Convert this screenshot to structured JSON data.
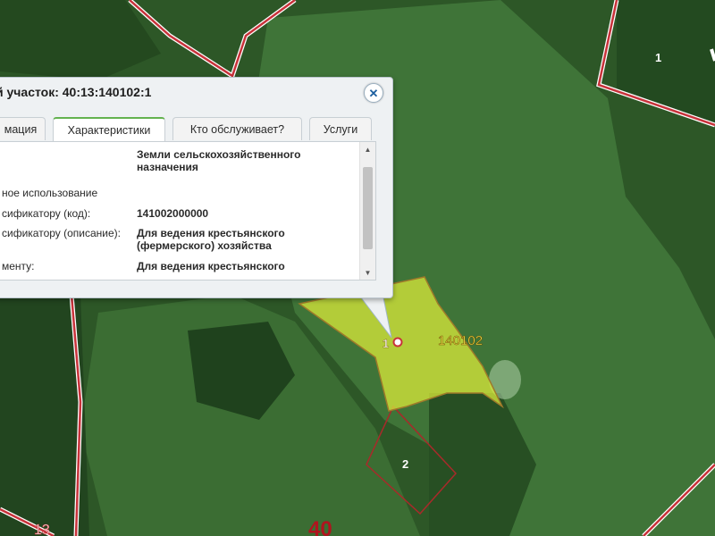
{
  "popup": {
    "title": "й участок: 40:13:140102:1",
    "close_symbol": "✕",
    "tabs": [
      {
        "label": "мация",
        "active": false
      },
      {
        "label": "Характеристики",
        "active": true
      },
      {
        "label": "Кто обслуживает?",
        "active": false
      },
      {
        "label": "Услуги",
        "active": false
      }
    ],
    "rows": [
      {
        "label": "",
        "value": "Земли сельскохозяйственного назначения"
      },
      {
        "label": "ное использование",
        "value": ""
      },
      {
        "label": "сификатору (код):",
        "value": "141002000000"
      },
      {
        "label": "сификатору (описание):",
        "value": "Для ведения крестьянского (фермерского) хозяйства"
      },
      {
        "label": "менту:",
        "value": "Для ведения крестьянского"
      }
    ]
  },
  "map": {
    "parcel_label": "140102",
    "marker_number": "1",
    "labels": {
      "plot_1": "1",
      "plot_2": "2",
      "district_13": "13",
      "district_40": "40"
    },
    "colors": {
      "boundary": "#c8323a",
      "selected_fill": "#d4e53a",
      "selected_stroke": "#9f7a2a"
    }
  }
}
